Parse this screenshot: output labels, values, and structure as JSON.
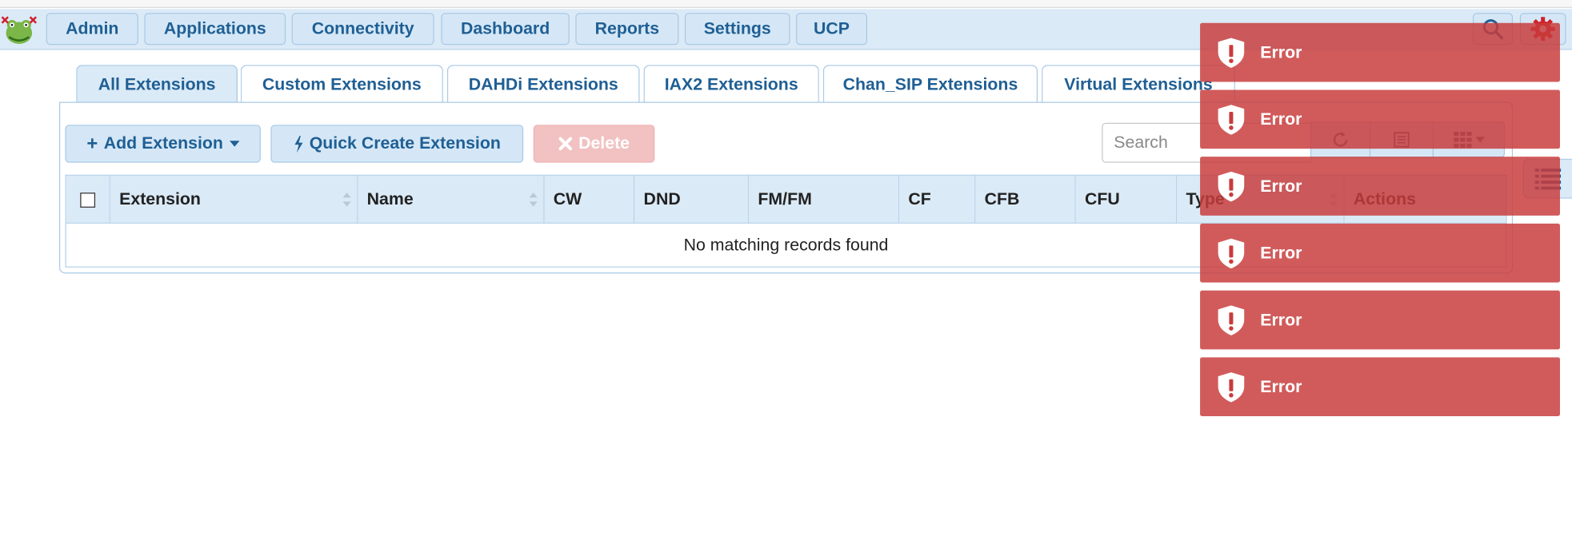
{
  "nav": {
    "items": [
      {
        "label": "Admin"
      },
      {
        "label": "Applications"
      },
      {
        "label": "Connectivity"
      },
      {
        "label": "Dashboard"
      },
      {
        "label": "Reports"
      },
      {
        "label": "Settings"
      },
      {
        "label": "UCP"
      }
    ],
    "search_icon": "search-icon",
    "settings_icon": "gear-icon"
  },
  "tabs": [
    {
      "label": "All Extensions",
      "active": true
    },
    {
      "label": "Custom Extensions"
    },
    {
      "label": "DAHDi Extensions"
    },
    {
      "label": "IAX2 Extensions"
    },
    {
      "label": "Chan_SIP Extensions"
    },
    {
      "label": "Virtual Extensions"
    }
  ],
  "toolbar": {
    "add_label": "Add Extension",
    "quick_create_label": "Quick Create Extension",
    "delete_label": "Delete",
    "search_placeholder": "Search"
  },
  "table": {
    "columns": [
      "Extension",
      "Name",
      "CW",
      "DND",
      "FM/FM",
      "CF",
      "CFB",
      "CFU",
      "Type",
      "Actions"
    ],
    "empty_message": "No matching records found"
  },
  "notifications": [
    {
      "title": "Error"
    },
    {
      "title": "Error"
    },
    {
      "title": "Error"
    },
    {
      "title": "Error"
    },
    {
      "title": "Error"
    },
    {
      "title": "Error"
    }
  ],
  "colors": {
    "nav_bg": "#dbeaf7",
    "accent_text": "#1f5f94",
    "error_bg": "#c83c3c",
    "gear_red": "#d0202a"
  }
}
